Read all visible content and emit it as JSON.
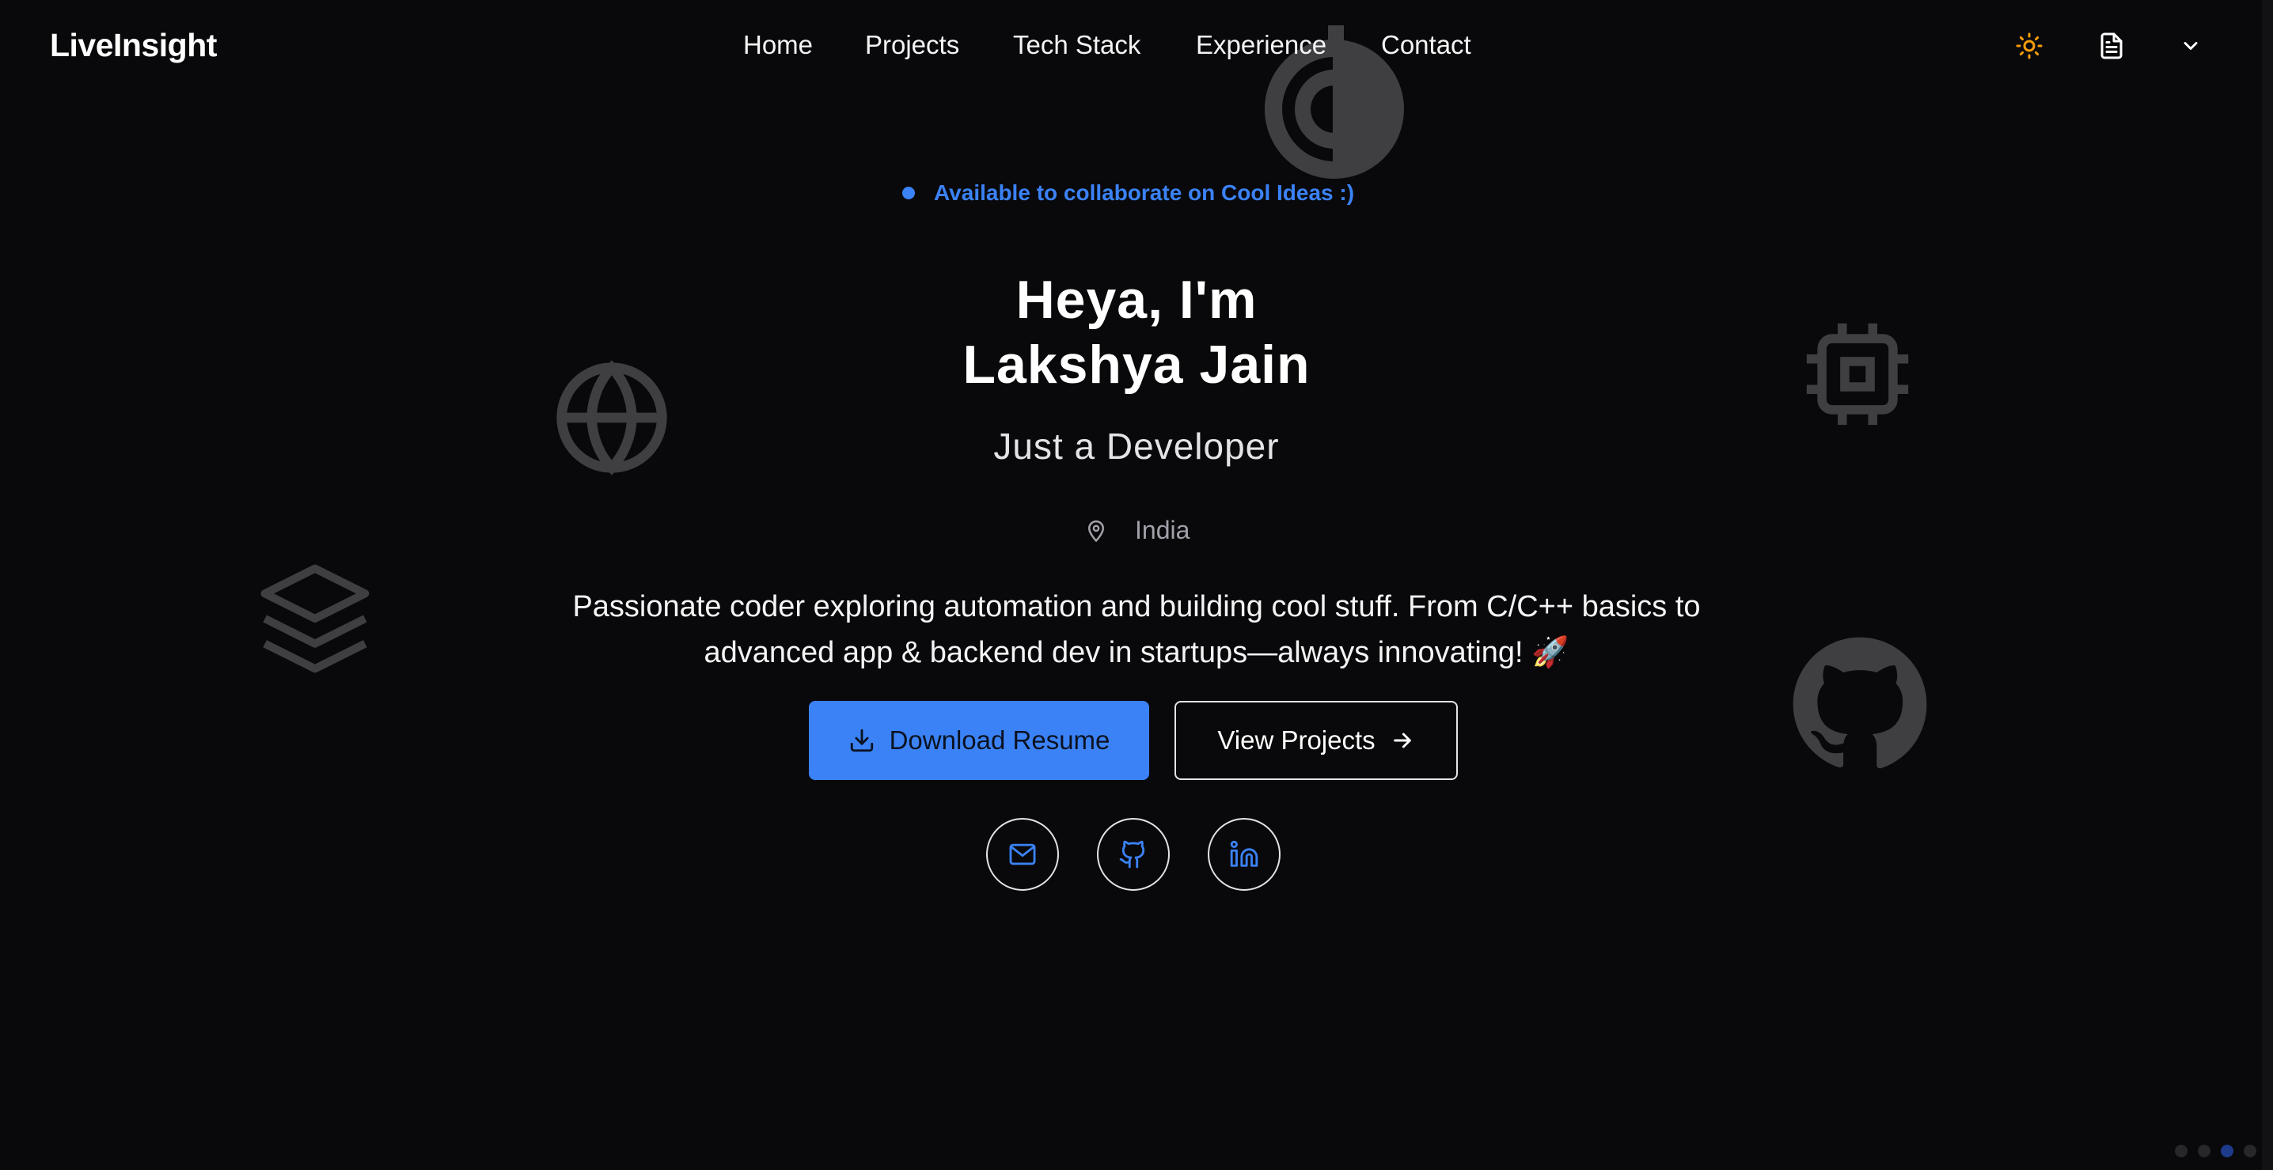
{
  "brand": "LiveInsight",
  "nav": {
    "items": [
      {
        "label": "Home"
      },
      {
        "label": "Projects"
      },
      {
        "label": "Tech Stack"
      },
      {
        "label": "Experience"
      },
      {
        "label": "Contact"
      }
    ]
  },
  "header_actions": {
    "theme_icon": "sun-icon",
    "resume_icon": "document-icon",
    "menu_icon": "chevron-down-icon"
  },
  "background_icons": [
    "globe-icon",
    "layers-icon",
    "chip-icon",
    "github-icon",
    "logo-mark-icon"
  ],
  "hero": {
    "badge": "Available to collaborate on Cool Ideas :)",
    "heading_line1": "Heya, I'm",
    "heading_line2": "Lakshya Jain",
    "subtitle": "Just a Developer",
    "location": "India",
    "description": "Passionate coder exploring automation and building cool stuff. From C/C++ basics to advanced app & backend dev in startups—always innovating! 🚀",
    "primary_button": "Download Resume",
    "secondary_button": "View Projects"
  },
  "socials": [
    "mail-icon",
    "github-icon",
    "linkedin-icon"
  ],
  "colors": {
    "background": "#09090b",
    "accent": "#3b82f6",
    "sun": "#f59e0b"
  },
  "pagination": {
    "total": 4,
    "active": 3
  }
}
